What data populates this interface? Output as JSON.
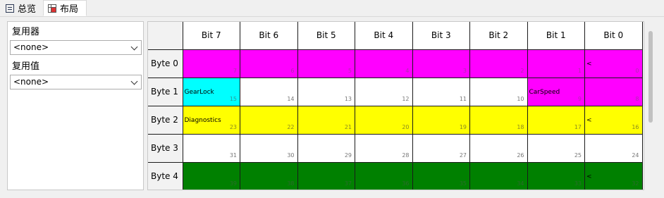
{
  "tabs": [
    {
      "label": "总览",
      "icon": "list-icon"
    },
    {
      "label": "布局",
      "icon": "grid-layout-icon"
    }
  ],
  "left": {
    "multiplexer_label": "复用器",
    "multiplexer_value": "<none>",
    "multiplex_value_label": "复用值",
    "multiplex_value_value": "<none>"
  },
  "grid": {
    "columns": [
      "Bit 7",
      "Bit 6",
      "Bit 5",
      "Bit 4",
      "Bit 3",
      "Bit 2",
      "Bit 1",
      "Bit 0"
    ],
    "rows": [
      {
        "label": "Byte 0",
        "cells": [
          {
            "color": "magenta",
            "bit": "7"
          },
          {
            "color": "magenta",
            "bit": "6"
          },
          {
            "color": "magenta",
            "bit": "5"
          },
          {
            "color": "magenta",
            "bit": "4"
          },
          {
            "color": "magenta",
            "bit": "3"
          },
          {
            "color": "magenta",
            "bit": "2"
          },
          {
            "color": "magenta",
            "bit": "1"
          },
          {
            "color": "magenta",
            "bit": "0",
            "text": "<"
          }
        ]
      },
      {
        "label": "Byte 1",
        "cells": [
          {
            "color": "cyan",
            "bit": "15",
            "text": "GearLock"
          },
          {
            "color": "white",
            "bit": "14"
          },
          {
            "color": "white",
            "bit": "13"
          },
          {
            "color": "white",
            "bit": "12"
          },
          {
            "color": "white",
            "bit": "11"
          },
          {
            "color": "white",
            "bit": "10"
          },
          {
            "color": "magenta",
            "bit": "9",
            "text": "CarSpeed"
          },
          {
            "color": "magenta",
            "bit": "8"
          }
        ]
      },
      {
        "label": "Byte 2",
        "cells": [
          {
            "color": "yellow",
            "bit": "23",
            "text": "Diagnostics"
          },
          {
            "color": "yellow",
            "bit": "22"
          },
          {
            "color": "yellow",
            "bit": "21"
          },
          {
            "color": "yellow",
            "bit": "20"
          },
          {
            "color": "yellow",
            "bit": "19"
          },
          {
            "color": "yellow",
            "bit": "18"
          },
          {
            "color": "yellow",
            "bit": "17"
          },
          {
            "color": "yellow",
            "bit": "16",
            "text": "<"
          }
        ]
      },
      {
        "label": "Byte 3",
        "cells": [
          {
            "color": "white",
            "bit": "31"
          },
          {
            "color": "white",
            "bit": "30"
          },
          {
            "color": "white",
            "bit": "29"
          },
          {
            "color": "white",
            "bit": "28"
          },
          {
            "color": "white",
            "bit": "27"
          },
          {
            "color": "white",
            "bit": "26"
          },
          {
            "color": "white",
            "bit": "25"
          },
          {
            "color": "white",
            "bit": "24"
          }
        ]
      },
      {
        "label": "Byte 4",
        "cells": [
          {
            "color": "green",
            "bit": "39"
          },
          {
            "color": "green",
            "bit": "38"
          },
          {
            "color": "green",
            "bit": "37"
          },
          {
            "color": "green",
            "bit": "36"
          },
          {
            "color": "green",
            "bit": "35"
          },
          {
            "color": "green",
            "bit": "34"
          },
          {
            "color": "green",
            "bit": "33"
          },
          {
            "color": "green",
            "bit": "32",
            "text": "<"
          }
        ]
      }
    ]
  },
  "colors": {
    "magenta": "#ff00ff",
    "cyan": "#00ffff",
    "yellow": "#ffff00",
    "green": "#008000",
    "white": "#ffffff"
  }
}
